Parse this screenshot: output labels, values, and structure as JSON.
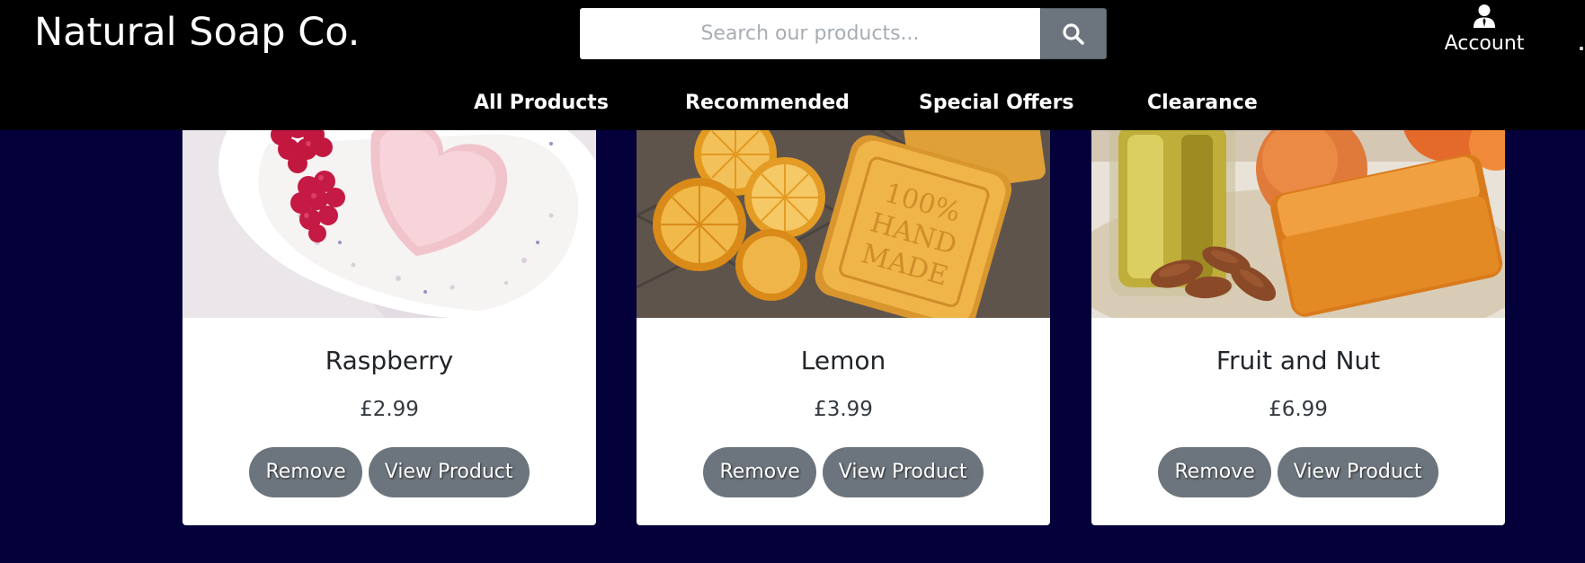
{
  "header": {
    "brand": "Natural Soap Co.",
    "search": {
      "placeholder": "Search our products...",
      "icon": "search-icon"
    },
    "account": {
      "label": "Account",
      "icon": "user-icon"
    },
    "nav": [
      {
        "label": "All Products"
      },
      {
        "label": "Recommended"
      },
      {
        "label": "Special Offers"
      },
      {
        "label": "Clearance"
      }
    ]
  },
  "products": [
    {
      "name": "Raspberry",
      "price": "£2.99",
      "remove_label": "Remove",
      "view_label": "View Product",
      "image": "raspberry-heart-soap"
    },
    {
      "name": "Lemon",
      "price": "£3.99",
      "remove_label": "Remove",
      "view_label": "View Product",
      "image": "lemon-handmade-soap"
    },
    {
      "name": "Fruit and Nut",
      "price": "£6.99",
      "remove_label": "Remove",
      "view_label": "View Product",
      "image": "apricot-almond-soap"
    }
  ],
  "colors": {
    "page_background": "#03003a",
    "header_background": "#000000",
    "button_background": "#6c757d",
    "card_background": "#ffffff"
  }
}
